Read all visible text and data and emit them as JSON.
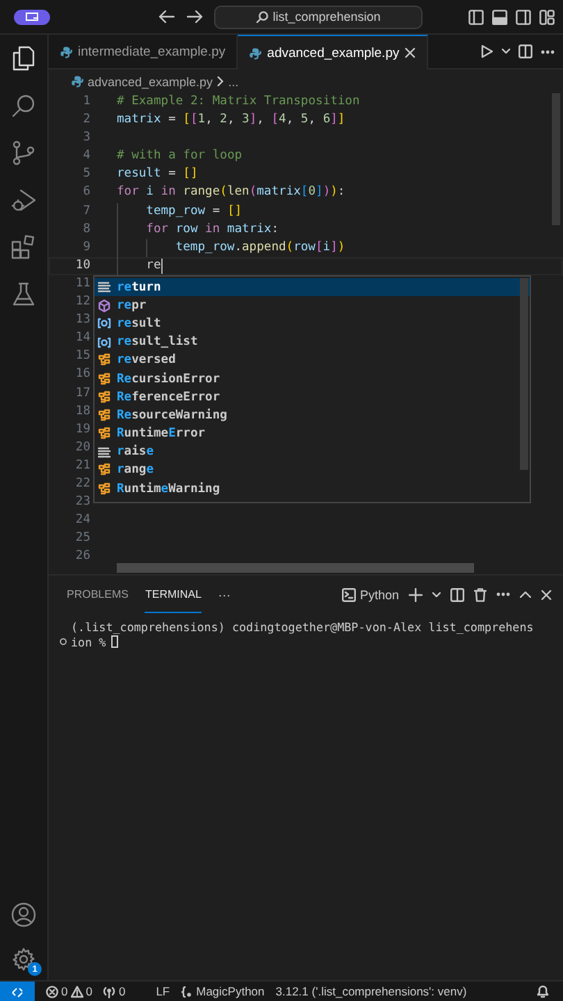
{
  "title_bar": {
    "search": "list_comprehension"
  },
  "activity_bar": {
    "settings_badge": "1"
  },
  "tabs": [
    {
      "label": "intermediate_example.py",
      "selected": false
    },
    {
      "label": "advanced_example.py",
      "selected": true
    }
  ],
  "breadcrumb": {
    "file": "advanced_example.py",
    "more": "..."
  },
  "editor": {
    "lines": [
      {
        "number": "1",
        "current": false,
        "tokens": [
          {
            "text": "# Example 2: Matrix Transposition",
            "kind": "comment"
          }
        ]
      },
      {
        "number": "2",
        "current": false,
        "tokens": [
          {
            "text": "matrix",
            "kind": "variable"
          },
          {
            "text": " = ",
            "kind": "plain"
          },
          {
            "text": "[",
            "kind": "bracket1"
          },
          {
            "text": "[",
            "kind": "bracket2"
          },
          {
            "text": "1",
            "kind": "number"
          },
          {
            "text": ", ",
            "kind": "plain"
          },
          {
            "text": "2",
            "kind": "number"
          },
          {
            "text": ", ",
            "kind": "plain"
          },
          {
            "text": "3",
            "kind": "number"
          },
          {
            "text": "]",
            "kind": "bracket2"
          },
          {
            "text": ", ",
            "kind": "plain"
          },
          {
            "text": "[",
            "kind": "bracket2"
          },
          {
            "text": "4",
            "kind": "number"
          },
          {
            "text": ", ",
            "kind": "plain"
          },
          {
            "text": "5",
            "kind": "number"
          },
          {
            "text": ", ",
            "kind": "plain"
          },
          {
            "text": "6",
            "kind": "number"
          },
          {
            "text": "]",
            "kind": "bracket2"
          },
          {
            "text": "]",
            "kind": "bracket1"
          }
        ]
      },
      {
        "number": "3",
        "current": false
      },
      {
        "number": "4",
        "current": false,
        "tokens": [
          {
            "text": "# with a for loop",
            "kind": "comment"
          }
        ]
      },
      {
        "number": "5",
        "current": false,
        "tokens": [
          {
            "text": "result",
            "kind": "variable"
          },
          {
            "text": " = ",
            "kind": "plain"
          },
          {
            "text": "[]",
            "kind": "bracket1"
          }
        ]
      },
      {
        "number": "6",
        "current": false,
        "tokens": [
          {
            "text": "for",
            "kind": "keyword"
          },
          {
            "text": " i ",
            "kind": "variable"
          },
          {
            "text": "in",
            "kind": "keyword"
          },
          {
            "text": " range",
            "kind": "function"
          },
          {
            "text": "(",
            "kind": "bracket1"
          },
          {
            "text": "len",
            "kind": "function"
          },
          {
            "text": "(",
            "kind": "bracket2"
          },
          {
            "text": "matrix",
            "kind": "variable"
          },
          {
            "text": "[",
            "kind": "bracket3"
          },
          {
            "text": "0",
            "kind": "number"
          },
          {
            "text": "]",
            "kind": "bracket3"
          },
          {
            "text": ")",
            "kind": "bracket2"
          },
          {
            "text": ")",
            "kind": "bracket1"
          },
          {
            "text": ":",
            "kind": "plain"
          }
        ]
      },
      {
        "number": "7",
        "current": false,
        "tokens": [
          {
            "text": "    temp_row",
            "kind": "variable"
          },
          {
            "text": " = ",
            "kind": "plain"
          },
          {
            "text": "[]",
            "kind": "bracket1"
          }
        ]
      },
      {
        "number": "8",
        "current": false,
        "tokens": [
          {
            "text": "    for",
            "kind": "keyword"
          },
          {
            "text": " row ",
            "kind": "variable"
          },
          {
            "text": "in",
            "kind": "keyword"
          },
          {
            "text": " matrix",
            "kind": "variable"
          },
          {
            "text": ":",
            "kind": "plain"
          }
        ]
      },
      {
        "number": "9",
        "current": false,
        "tokens": [
          {
            "text": "        temp_row",
            "kind": "variable"
          },
          {
            "text": ".",
            "kind": "plain"
          },
          {
            "text": "append",
            "kind": "function"
          },
          {
            "text": "(",
            "kind": "bracket1"
          },
          {
            "text": "row",
            "kind": "variable"
          },
          {
            "text": "[",
            "kind": "bracket2"
          },
          {
            "text": "i",
            "kind": "variable"
          },
          {
            "text": "]",
            "kind": "bracket2"
          },
          {
            "text": ")",
            "kind": "bracket1"
          }
        ]
      },
      {
        "number": "10",
        "current": true,
        "tokens": [
          {
            "text": "    re",
            "kind": "plain"
          }
        ]
      },
      {
        "number": "11",
        "current": false
      },
      {
        "number": "12",
        "current": false
      },
      {
        "number": "13",
        "current": false
      },
      {
        "number": "14",
        "current": false
      },
      {
        "number": "15",
        "current": false
      },
      {
        "number": "16",
        "current": false
      },
      {
        "number": "17",
        "current": false
      },
      {
        "number": "18",
        "current": false
      },
      {
        "number": "19",
        "current": false
      },
      {
        "number": "20",
        "current": false
      },
      {
        "number": "21",
        "current": false
      },
      {
        "number": "22",
        "current": false
      },
      {
        "number": "23",
        "current": false
      },
      {
        "number": "24",
        "current": false
      },
      {
        "number": "25",
        "current": false
      },
      {
        "number": "26",
        "current": false
      }
    ]
  },
  "autocomplete": {
    "items": [
      {
        "kind": "keyword",
        "selected": true,
        "parts": [
          {
            "text": "re",
            "match": true
          },
          {
            "text": "turn",
            "match": false
          }
        ]
      },
      {
        "kind": "function",
        "selected": false,
        "parts": [
          {
            "text": "re",
            "match": true
          },
          {
            "text": "pr",
            "match": false
          }
        ]
      },
      {
        "kind": "variable",
        "selected": false,
        "parts": [
          {
            "text": "re",
            "match": true
          },
          {
            "text": "sult",
            "match": false
          }
        ]
      },
      {
        "kind": "variable",
        "selected": false,
        "parts": [
          {
            "text": "re",
            "match": true
          },
          {
            "text": "sult_list",
            "match": false
          }
        ]
      },
      {
        "kind": "class",
        "selected": false,
        "parts": [
          {
            "text": "re",
            "match": true
          },
          {
            "text": "versed",
            "match": false
          }
        ]
      },
      {
        "kind": "class",
        "selected": false,
        "parts": [
          {
            "text": "Re",
            "match": true
          },
          {
            "text": "cursionError",
            "match": false
          }
        ]
      },
      {
        "kind": "class",
        "selected": false,
        "parts": [
          {
            "text": "Re",
            "match": true
          },
          {
            "text": "ferenceError",
            "match": false
          }
        ]
      },
      {
        "kind": "class",
        "selected": false,
        "parts": [
          {
            "text": "Re",
            "match": true
          },
          {
            "text": "sourceWarning",
            "match": false
          }
        ]
      },
      {
        "kind": "class",
        "selected": false,
        "parts": [
          {
            "text": "R",
            "match": true
          },
          {
            "text": "untime",
            "match": false
          },
          {
            "text": "E",
            "match": true
          },
          {
            "text": "rror",
            "match": false
          }
        ]
      },
      {
        "kind": "keyword",
        "selected": false,
        "parts": [
          {
            "text": "r",
            "match": true
          },
          {
            "text": "ais",
            "match": false
          },
          {
            "text": "e",
            "match": true
          }
        ]
      },
      {
        "kind": "class",
        "selected": false,
        "parts": [
          {
            "text": "r",
            "match": true
          },
          {
            "text": "ang",
            "match": false
          },
          {
            "text": "e",
            "match": true
          }
        ]
      },
      {
        "kind": "class",
        "selected": false,
        "parts": [
          {
            "text": "R",
            "match": true
          },
          {
            "text": "untim",
            "match": false
          },
          {
            "text": "e",
            "match": true
          },
          {
            "text": "Warning",
            "match": false
          }
        ]
      }
    ]
  },
  "panel": {
    "tabs": [
      {
        "label": "PROBLEMS",
        "selected": false
      },
      {
        "label": "TERMINAL",
        "selected": true
      }
    ],
    "more": "···",
    "terminal_name": "Python",
    "terminal_lines": [
      "(.list_comprehensions) codingtogether@MBP-von-Alex list_comprehens",
      "ion %"
    ]
  },
  "status_bar": {
    "errors": "0",
    "warnings": "0",
    "ports": "0",
    "eol": "LF",
    "language": "MagicPython",
    "interpreter": "3.12.1 ('.list_comprehensions': venv)"
  }
}
